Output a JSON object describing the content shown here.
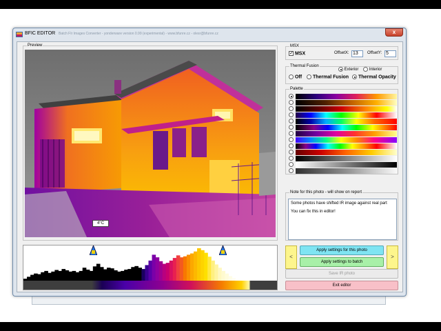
{
  "window": {
    "title": "BFIC EDITOR",
    "subtitle": "Batch FIr Images Converter - yonderware version 0.99 (experimental) - www.bfunre.cz - olesr@bfunre.cz",
    "close_glyph": "x"
  },
  "preview": {
    "legend": "Preview",
    "temp_label": "4°C"
  },
  "msx": {
    "legend": "MSX",
    "checkbox_label": "MSX",
    "checked": true,
    "offset_x_label": "OffsetX:",
    "offset_x_value": "13",
    "offset_y_label": "OffsetY:",
    "offset_y_value": "5"
  },
  "thermal_fusion": {
    "legend": "Thermal Fusion",
    "mode_options": [
      "Exterior",
      "Interior"
    ],
    "mode_selected": "Exterior",
    "options": [
      "Off",
      "Thermal Fusion",
      "Thermal Opacity"
    ],
    "selected": "Thermal Opacity"
  },
  "palette": {
    "legend": "Palette",
    "selected_index": 0,
    "swatches": [
      "linear-gradient(to right,#000 0%,#2a007a 20%,#8a00a0 40%,#e0205a 60%,#ff9a00 80%,#fff6a0 100%)",
      "linear-gradient(to right,#000 0%,#502000 30%,#c06000 55%,#ffb000 80%,#ffffc0 100%)",
      "linear-gradient(to right,#000 0%,#600 25%,#c00 45%,#f80 70%,#ff0 90%,#fff 100%)",
      "linear-gradient(to right,#204 0%,#00f 15%,#0ff 30%,#0f0 45%,#ff0 62%,#f00 80%,#fff 100%)",
      "linear-gradient(to right,#000 0%,#00a 15%,#0af 30%,#0f6 45%,#ff0 60%,#f60 78%,#f00 100%)",
      "linear-gradient(to right,#000 0%,#808 18%,#00f 32%,#0ff 46%,#0f0 60%,#ff0 76%,#f00 100%)",
      "linear-gradient(to right,#200040 0%,#7000a0 20%,#e000a0 40%,#ff3030 58%,#ffa000 78%,#ffff90 100%)",
      "linear-gradient(to right,#40f 0%,#08f 15%,#0f8 30%,#ff0 45%,#f80 60%,#f08 78%,#80f 100%)",
      "linear-gradient(to right,#000 0%,#808 10%,#00f 20%,#0ff 32%,#0f0 44%,#ff0 56%,#f80 68%,#f00 80%,#fff 100%)",
      "linear-gradient(to right,#600 0%,#c00 25%,#f60 50%,#fc0 75%,#ffc 100%)",
      "linear-gradient(to right,#000 0%,#404040 25%,#808080 50%,#c0c0c0 75%,#fff 100%)",
      "linear-gradient(to right,#fff 0%,#c0c0c0 25%,#808080 50%,#404040 75%,#000 100%)",
      "linear-gradient(to right,#303030 0%,#606060 25%,#909090 50%,#c8c8c8 75%,#f8f8f8 100%)"
    ]
  },
  "note": {
    "legend": "Note for this photo - will show on report",
    "line1": "Some photos have shifted IR image against real part",
    "line2": "You can fix this in editor!"
  },
  "actions": {
    "prev_glyph": "<",
    "next_glyph": ">",
    "apply_photo": "Apply settings for this photo",
    "apply_batch": "Apply settings to batch",
    "save_ir": "Save IR photo",
    "exit": "Exit editor"
  },
  "histogram": {
    "values": [
      0.06,
      0.12,
      0.18,
      0.22,
      0.2,
      0.26,
      0.3,
      0.24,
      0.28,
      0.33,
      0.3,
      0.36,
      0.32,
      0.28,
      0.3,
      0.26,
      0.3,
      0.4,
      0.34,
      0.3,
      0.44,
      0.52,
      0.42,
      0.35,
      0.4,
      0.38,
      0.32,
      0.28,
      0.3,
      0.34,
      0.36,
      0.42,
      0.45,
      0.4,
      0.36,
      0.48,
      0.62,
      0.8,
      0.72,
      0.6,
      0.52,
      0.55,
      0.62,
      0.7,
      0.78,
      0.72,
      0.75,
      0.8,
      0.84,
      0.9,
      1.0,
      0.94,
      0.86,
      0.74,
      0.62,
      0.5,
      0.4,
      0.3,
      0.22,
      0.14,
      0.08,
      0.04,
      0.02,
      0.01,
      0.005,
      0,
      0,
      0,
      0,
      0,
      0,
      0,
      0
    ],
    "colors": [
      "#000",
      "#000",
      "#000",
      "#000",
      "#000",
      "#000",
      "#000",
      "#000",
      "#000",
      "#000",
      "#000",
      "#000",
      "#000",
      "#000",
      "#000",
      "#000",
      "#000",
      "#000",
      "#000",
      "#000",
      "#000",
      "#000",
      "#000",
      "#000",
      "#000",
      "#000",
      "#000",
      "#000",
      "#000",
      "#000",
      "#000",
      "#000",
      "#000",
      "#000",
      "#1a0060",
      "#3a0090",
      "#5a00a8",
      "#7a00a8",
      "#8e00a0",
      "#a00090",
      "#b80080",
      "#c80070",
      "#d81060",
      "#e82050",
      "#f04040",
      "#f45a20",
      "#f87800",
      "#fa9000",
      "#fca800",
      "#fdb800",
      "#fdc800",
      "#fed400",
      "#fee000",
      "#ffe840",
      "#fff080",
      "#fff4a0",
      "#fff8c0",
      "#fffad0",
      "#fffcdc",
      "#fffde6",
      "#fffeee",
      "#fff",
      "#fff",
      "#fff",
      "#fff",
      "#fff",
      "#fff",
      "#fff",
      "#fff",
      "#fff",
      "#fff",
      "#fff",
      "#fff"
    ]
  }
}
